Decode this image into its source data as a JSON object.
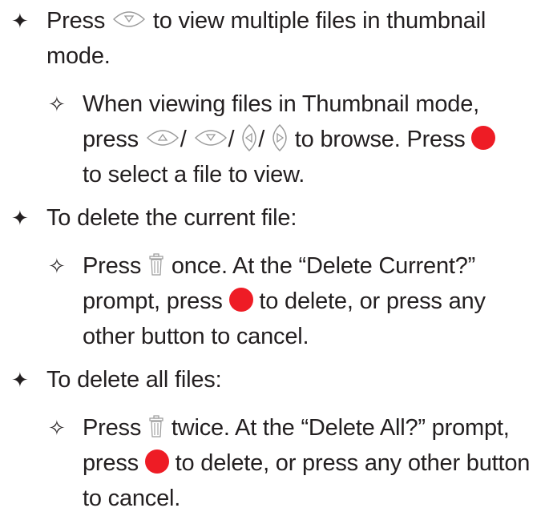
{
  "bullets": {
    "primary": "✦",
    "secondary": "✧"
  },
  "items": [
    {
      "parts": [
        "Press",
        "to view multiple files in thumbnail",
        "mode."
      ]
    },
    {
      "parts": [
        "When viewing files in Thumbnail mode,",
        "press",
        "/",
        "/",
        "/",
        "to browse. Press",
        "to select a file to view."
      ]
    },
    {
      "parts": [
        "To delete the current file:"
      ]
    },
    {
      "parts": [
        "Press",
        "once. At the “Delete Current?”",
        "prompt, press",
        "to delete, or press any",
        "other button to cancel."
      ]
    },
    {
      "parts": [
        "To delete all files:"
      ]
    },
    {
      "parts": [
        "Press",
        "twice. At the “Delete All?” prompt,",
        "press",
        "to delete, or press any other button",
        "to cancel."
      ]
    }
  ],
  "icons": {
    "down": "down-button-icon",
    "up": "up-button-icon",
    "left": "left-button-icon",
    "right": "right-button-icon",
    "ok": "ok-button-icon",
    "trash": "trash-button-icon"
  },
  "colors": {
    "text": "#231f20",
    "ok_button": "#ee1c25",
    "icon_stroke": "#9a9a9a"
  }
}
